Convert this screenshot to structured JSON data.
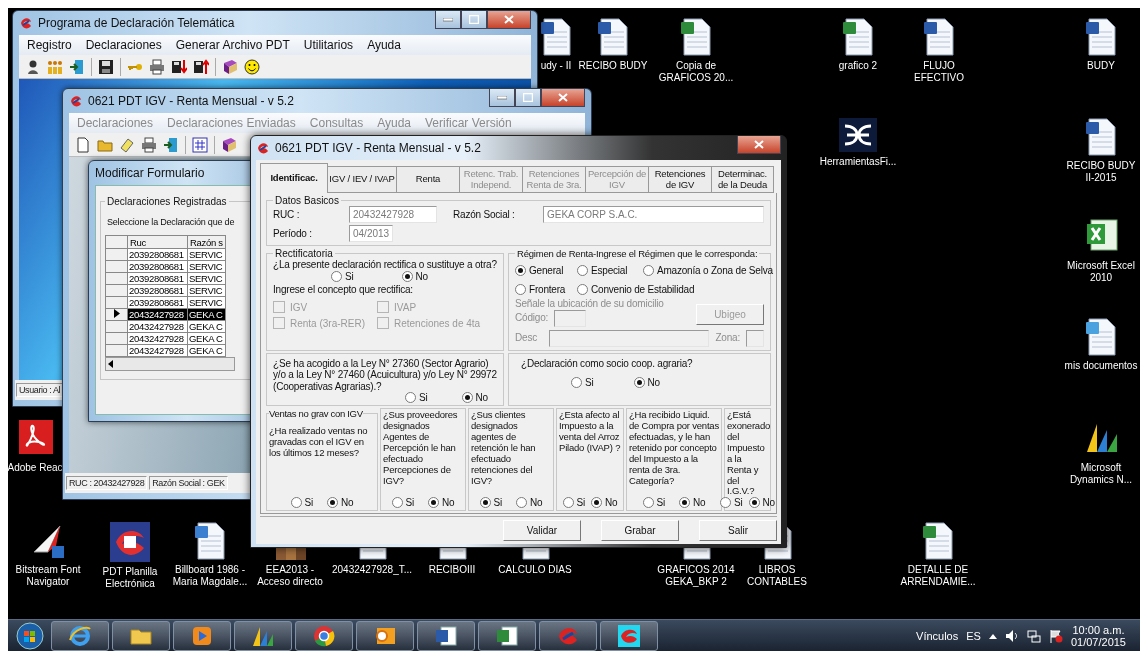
{
  "desktop_icons": [
    {
      "label": "udy - II",
      "kind": "word"
    },
    {
      "label": "RECIBO BUDY",
      "kind": "word"
    },
    {
      "label": "Copia de GRAFICOS 20...",
      "kind": "excel"
    },
    {
      "label": "grafico 2",
      "kind": "excel"
    },
    {
      "label": "FLUJO EFECTIVO",
      "kind": "word"
    },
    {
      "label": "BUDY",
      "kind": "word"
    },
    {
      "label": "HerramientasFi...",
      "kind": "logo"
    },
    {
      "label": "RECIBO BUDY II-2015",
      "kind": "word"
    },
    {
      "label": "Microsoft Excel 2010",
      "kind": "excelapp"
    },
    {
      "label": "mis documentos",
      "kind": "docs"
    },
    {
      "label": "Adobe Reac",
      "kind": "pdf"
    },
    {
      "label": "Microsoft Dynamics N...",
      "kind": "dynamics"
    },
    {
      "label": "Bitstream Font Navigator",
      "kind": "font"
    },
    {
      "label": "PDT Planilla Electrónica",
      "kind": "pdt"
    },
    {
      "label": "Billboard 1986 - Maria Magdale...",
      "kind": "mp3"
    },
    {
      "label": "EEA2013 - Acceso directo",
      "kind": "castle"
    },
    {
      "label": "20432427928_T...",
      "kind": "file"
    },
    {
      "label": "RECIBOIII",
      "kind": "word"
    },
    {
      "label": "CALCULO DIAS",
      "kind": "excel"
    },
    {
      "label": "GRAFICOS 2014 GEKA_BKP 2",
      "kind": "excel"
    },
    {
      "label": "LIBROS CONTABLES",
      "kind": "excel"
    },
    {
      "label": "DETALLE DE ARRENDAMIE...",
      "kind": "excel"
    }
  ],
  "main_window": {
    "title": "Programa de Declaración Telemática",
    "menu": [
      "Registro",
      "Declaraciones",
      "Generar Archivo PDT",
      "Utilitarios",
      "Ayuda"
    ],
    "status": "Usuario : Al"
  },
  "pdt_window": {
    "title": "0621 PDT IGV - Renta Mensual - v 5.2",
    "menu": [
      {
        "label": "Declaraciones",
        "disabled": true
      },
      {
        "label": "Declaraciones Enviadas",
        "disabled": true
      },
      {
        "label": "Consultas",
        "disabled": true
      },
      {
        "label": "Ayuda",
        "disabled": true
      },
      {
        "label": "Verificar Versión",
        "disabled": true
      }
    ],
    "status_bar": [
      "RUC : 20432427928",
      "Razón Social : GEK"
    ]
  },
  "modify_dialog": {
    "title": "Modificar Formulario",
    "group": "Declaraciones Registradas",
    "prompt": "Seleccione la Declaración que de",
    "columns": [
      "Ruc",
      "Razón s"
    ],
    "rows": [
      {
        "ruc": "20392808681",
        "name": "SERVIC",
        "selected": false
      },
      {
        "ruc": "20392808681",
        "name": "SERVIC",
        "selected": false
      },
      {
        "ruc": "20392808681",
        "name": "SERVIC",
        "selected": false
      },
      {
        "ruc": "20392808681",
        "name": "SERVIC",
        "selected": false
      },
      {
        "ruc": "20392808681",
        "name": "SERVIC",
        "selected": false
      },
      {
        "ruc": "20432427928",
        "name": "GEKA C",
        "selected": true
      },
      {
        "ruc": "20432427928",
        "name": "GEKA C",
        "selected": false
      },
      {
        "ruc": "20432427928",
        "name": "GEKA C",
        "selected": false
      },
      {
        "ruc": "20432427928",
        "name": "GEKA C",
        "selected": false
      }
    ]
  },
  "form": {
    "title": "0621 PDT IGV - Renta Mensual - v 5.2",
    "tabs": [
      {
        "label": "Identificac.",
        "selected": true,
        "disabled": false
      },
      {
        "label": "IGV / IEV / IVAP",
        "selected": false,
        "disabled": false
      },
      {
        "label": "Renta",
        "selected": false,
        "disabled": false
      },
      {
        "label": "Retenc. Trab. Independ.",
        "selected": false,
        "disabled": true
      },
      {
        "label": "Retenciones Renta de 3ra.",
        "selected": false,
        "disabled": true
      },
      {
        "label": "Percepción de IGV",
        "selected": false,
        "disabled": true
      },
      {
        "label": "Retenciones de IGV",
        "selected": false,
        "disabled": false
      },
      {
        "label": "Determinac. de la Deuda",
        "selected": false,
        "disabled": false
      }
    ],
    "datos_basicos": {
      "title": "Datos Basicos",
      "ruc_label": "RUC :",
      "ruc": "20432427928",
      "razon_label": "Razón Social :",
      "razon": "GEKA CORP S.A.C.",
      "periodo_label": "Período :",
      "periodo": "04/2013"
    },
    "rectificatoria": {
      "title": "Rectificatoria",
      "question": "¿La presente declaración rectifica o sustituye a otra?",
      "options": [
        {
          "label": "Si",
          "selected": false
        },
        {
          "label": "No",
          "selected": true
        }
      ],
      "concept_label": "Ingrese el concepto que rectifica:",
      "concepts": [
        {
          "label": "IGV",
          "checked": false,
          "disabled": true
        },
        {
          "label": "IVAP",
          "checked": false,
          "disabled": true
        },
        {
          "label": "Renta (3ra-RER)",
          "checked": false,
          "disabled": true
        },
        {
          "label": "Retenciones de 4ta",
          "checked": false,
          "disabled": true
        }
      ]
    },
    "regimen": {
      "title": "Régimen de Renta-Ingrese el Régimen que le corresponda:",
      "options": [
        {
          "label": "General",
          "selected": true
        },
        {
          "label": "Especial",
          "selected": false
        },
        {
          "label": "Amazonía o Zona de Selva",
          "selected": false
        },
        {
          "label": "Frontera",
          "selected": false
        },
        {
          "label": "Convenio de Estabilidad",
          "selected": false
        }
      ],
      "domicilio_label": "Señale la ubicación de su domicilio",
      "codigo_label": "Código:",
      "ubigeo_button": {
        "label": "Ubigeo",
        "disabled": true
      },
      "desc_label": "Desc",
      "zona_label": "Zona:"
    },
    "ley": {
      "question": "¿Se ha acogido a la Ley N° 27360 (Sector Agrario) y/o a la Ley N° 27460 (Acuicultura) y/o Ley N° 29972 (Cooperativas Agrarias).?",
      "options": [
        {
          "label": "Si",
          "selected": false
        },
        {
          "label": "No",
          "selected": true
        }
      ]
    },
    "socio": {
      "question": "¿Declaración como socio coop. agraria?",
      "options": [
        {
          "label": "Si",
          "selected": false
        },
        {
          "label": "No",
          "selected": true
        }
      ]
    },
    "questions": [
      {
        "title": "Ventas no grav con IGV",
        "question": "¿Ha realizado ventas no gravadas con el IGV en los últimos 12 meses?",
        "options": [
          {
            "label": "Si",
            "selected": false
          },
          {
            "label": "No",
            "selected": true
          }
        ]
      },
      {
        "question": "¿Sus proveedores designados Agentes de Percepción le han efectuado Percepciones de IGV?",
        "options": [
          {
            "label": "Si",
            "selected": false
          },
          {
            "label": "No",
            "selected": true
          }
        ]
      },
      {
        "question": "¿Sus clientes designados agentes de retención le han efectuado retenciones del IGV?",
        "options": [
          {
            "label": "Si",
            "selected": true
          },
          {
            "label": "No",
            "selected": false
          }
        ]
      },
      {
        "question": "¿Esta afecto al Impuesto a la venta del Arroz Pilado (IVAP) ?",
        "options": [
          {
            "label": "Si",
            "selected": false
          },
          {
            "label": "No",
            "selected": true
          }
        ]
      },
      {
        "question": "¿Ha recibido Liquid. de Compra por ventas efectuadas, y le han retenido por concepto del Impuesto a la renta de 3ra. Categoría?",
        "options": [
          {
            "label": "Si",
            "selected": false
          },
          {
            "label": "No",
            "selected": true
          }
        ]
      },
      {
        "question": "¿Está exonerado del Impuesto a la Renta y del I.G.V.?",
        "options": [
          {
            "label": "Si",
            "selected": false
          },
          {
            "label": "No",
            "selected": true
          }
        ]
      }
    ],
    "buttons": [
      "Validar",
      "Grabar",
      "Salir"
    ]
  },
  "taskbar": {
    "tray_label": "Vínculos",
    "language": "ES",
    "time": "10:00 a.m.",
    "date": "01/07/2015"
  }
}
